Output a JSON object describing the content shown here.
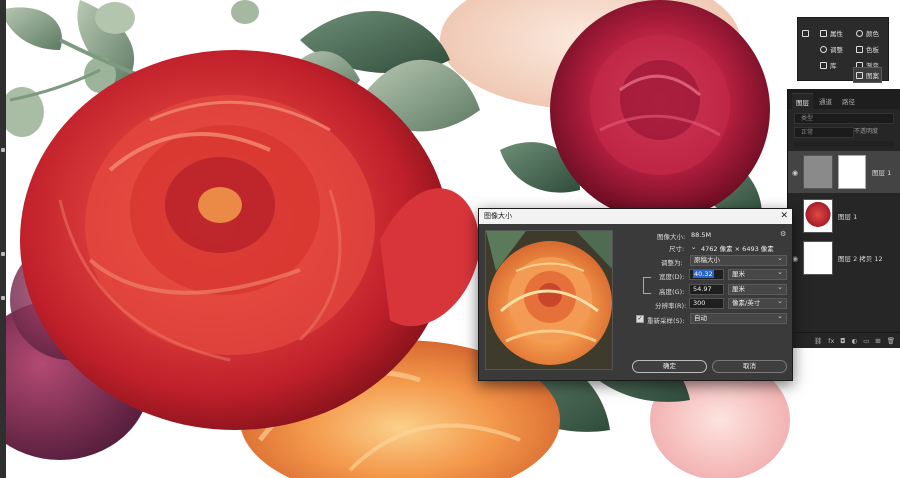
{
  "adjustments_panel": {
    "items": [
      {
        "icon": "brush-icon",
        "label": ""
      },
      {
        "icon": "pencil-icon",
        "label": "属性"
      },
      {
        "icon": "circle-half-icon",
        "label": "调整"
      },
      {
        "icon": "library-icon",
        "label": "库"
      },
      {
        "icon": "swatch-icon",
        "label": "颜色"
      },
      {
        "icon": "grid-icon",
        "label": "色板"
      },
      {
        "icon": "gradient-icon",
        "label": "渐变"
      },
      {
        "icon": "pattern-icon",
        "label": "图案"
      }
    ]
  },
  "layers_panel": {
    "tabs": [
      "图层",
      "通道",
      "路径"
    ],
    "kind_label": "类型",
    "blend_mode": "正常",
    "opacity_label": "不透明度",
    "layers": [
      {
        "name": "图层 1",
        "selected": true
      },
      {
        "name": "图层 1",
        "selected": false
      },
      {
        "name": "图层 2 拷贝 12",
        "selected": false
      }
    ],
    "bottom_icons": [
      "link-icon",
      "fx-icon",
      "mask-icon",
      "adjustment-icon",
      "folder-icon",
      "new-layer-icon",
      "trash-icon"
    ]
  },
  "dialog": {
    "title": "图像大小",
    "image_size_label": "图像大小:",
    "image_size_value": "88.5M",
    "dimensions_label": "尺寸:",
    "dimensions_value": "4762 像素 × 6493 像素",
    "fit_label": "调整为:",
    "fit_value": "原稿大小",
    "width_label": "宽度(D):",
    "width_value": "40.32",
    "width_unit": "厘米",
    "height_label": "高度(G):",
    "height_value": "54.97",
    "height_unit": "厘米",
    "resolution_label": "分辨率(R):",
    "resolution_value": "300",
    "resolution_unit": "像素/英寸",
    "resample_label": "重新采样(S):",
    "resample_value": "自动",
    "resample_checked": true,
    "ok_label": "确定",
    "cancel_label": "取消"
  },
  "colors": {
    "panel_bg": "#262626",
    "dialog_bg": "#3a3a3a",
    "highlight": "#2965c8"
  }
}
